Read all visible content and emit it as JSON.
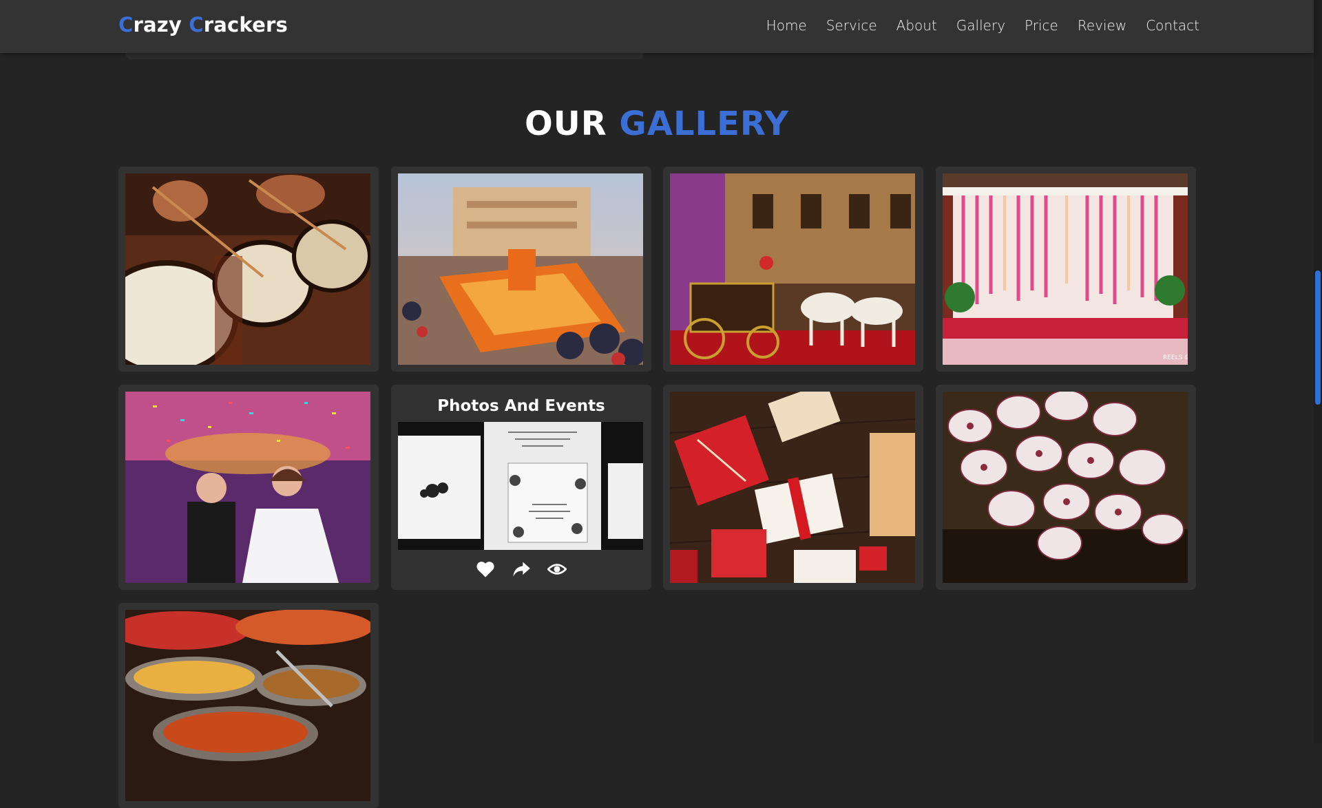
{
  "brand": {
    "letter1": "C",
    "word1": "razy",
    "letter2": "C",
    "word2": "rackers",
    "accent_color": "#3b6fd6"
  },
  "nav": [
    "Home",
    "Service",
    "About",
    "Gallery",
    "Price",
    "Review",
    "Contact"
  ],
  "gallery": {
    "title_part1": "OUR",
    "title_part2": "GALLERY",
    "hover_card_title": "Photos And Events",
    "images": [
      "drummers",
      "palace-courtyard-event",
      "horse-carriage-palace",
      "floral-stage-decor",
      "wedding-confetti-dance",
      "wedding-invitation-cards",
      "gift-boxes",
      "decorated-cookies",
      "food-buffet"
    ],
    "watermark_text": "REELS & FR",
    "action_icons": [
      "heart-icon",
      "share-icon",
      "eye-icon"
    ]
  },
  "colors": {
    "background": "#242424",
    "header": "#333333",
    "card": "#323232",
    "scroll_thumb": "#2e6fd8"
  }
}
